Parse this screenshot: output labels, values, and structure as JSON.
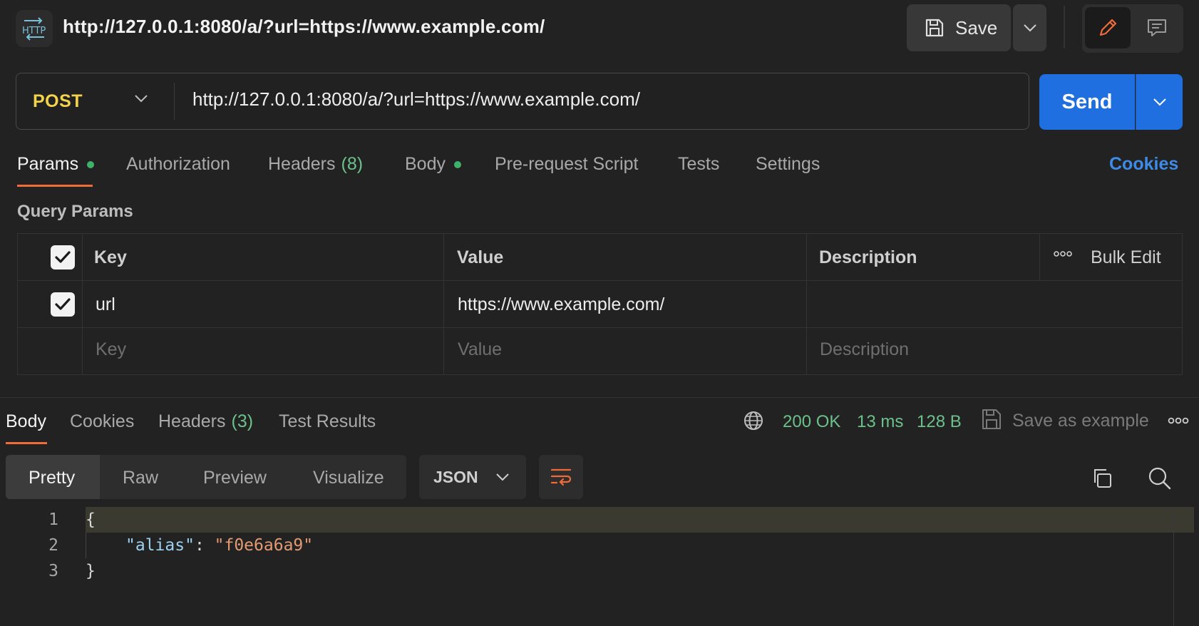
{
  "header": {
    "logo_text": "HTTP",
    "title": "http://127.0.0.1:8080/a/?url=https://www.example.com/",
    "save_label": "Save"
  },
  "request": {
    "method": "POST",
    "url": "http://127.0.0.1:8080/a/?url=https://www.example.com/",
    "send_label": "Send"
  },
  "request_tabs": {
    "params": "Params",
    "authorization": "Authorization",
    "headers": "Headers",
    "headers_count": "(8)",
    "body": "Body",
    "pre_request": "Pre-request Script",
    "tests": "Tests",
    "settings": "Settings",
    "cookies": "Cookies"
  },
  "query_params": {
    "section_label": "Query Params",
    "columns": {
      "key": "Key",
      "value": "Value",
      "description": "Description"
    },
    "bulk_edit": "Bulk Edit",
    "rows": [
      {
        "checked": true,
        "key": "url",
        "value": "https://www.example.com/",
        "description": ""
      }
    ],
    "placeholder": {
      "key": "Key",
      "value": "Value",
      "description": "Description"
    }
  },
  "response_tabs": {
    "body": "Body",
    "cookies": "Cookies",
    "headers": "Headers",
    "headers_count": "(3)",
    "test_results": "Test Results"
  },
  "response_status": {
    "status": "200 OK",
    "time": "13 ms",
    "size": "128 B",
    "save_example": "Save as example"
  },
  "view": {
    "modes": [
      "Pretty",
      "Raw",
      "Preview",
      "Visualize"
    ],
    "active_mode": "Pretty",
    "format": "JSON"
  },
  "code": {
    "line_numbers": [
      "1",
      "2",
      "3"
    ],
    "open_brace": "{",
    "close_brace": "}",
    "key": "\"alias\"",
    "colon": ": ",
    "value": "\"f0e6a6a9\""
  },
  "colors": {
    "background": "#222222",
    "accent": "#ef6c3a",
    "send": "#1f6fe0",
    "method": "#f3d24c",
    "status_ok": "#6cc18b",
    "link": "#3d8be6"
  }
}
